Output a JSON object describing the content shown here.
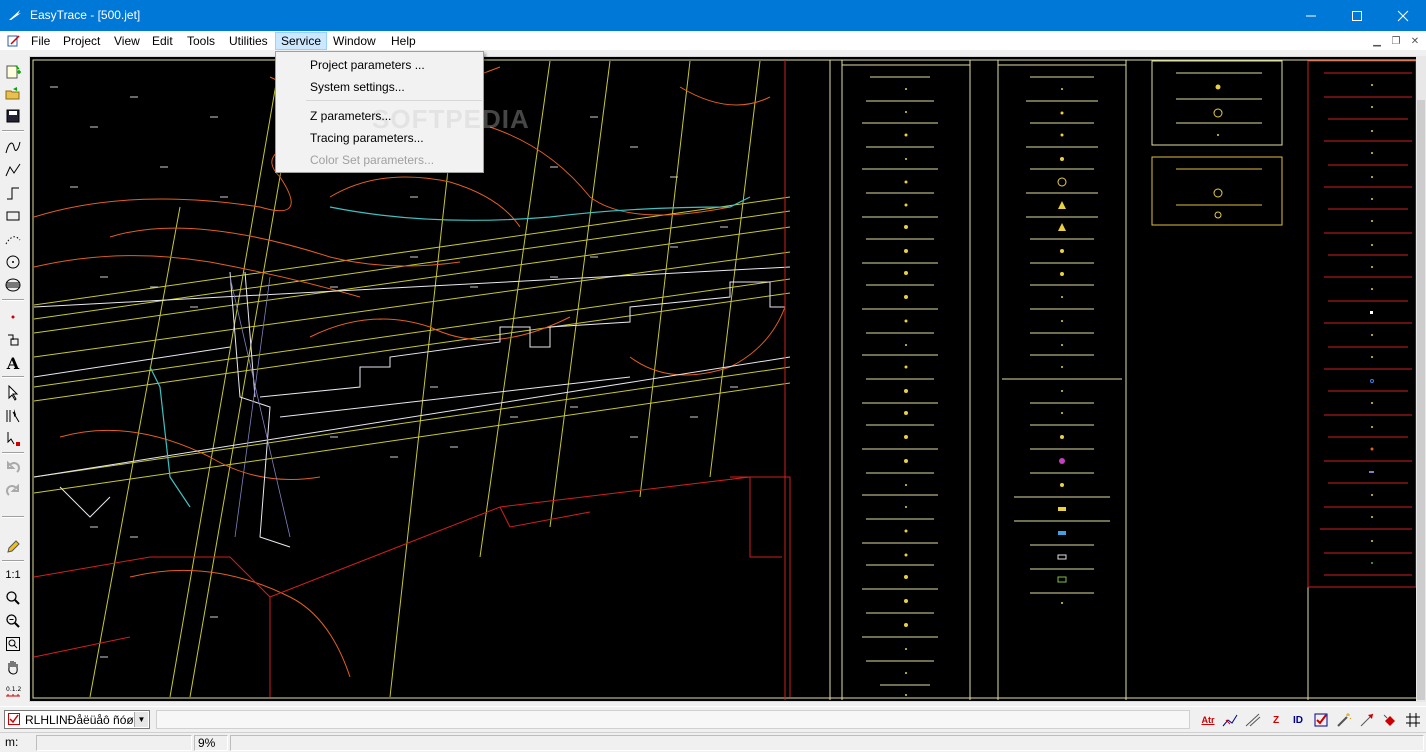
{
  "window": {
    "title": "EasyTrace - [500.jet]",
    "minimize_icon": "minimize-icon",
    "maximize_icon": "maximize-icon",
    "close_icon": "close-icon"
  },
  "menubar": {
    "items": [
      "File",
      "Project",
      "View",
      "Edit",
      "Tools",
      "Utilities",
      "Service",
      "Window",
      "Help"
    ],
    "active": "Service"
  },
  "service_menu": {
    "items": [
      {
        "label": "Project parameters ...",
        "enabled": true
      },
      {
        "label": "System settings...",
        "enabled": true
      },
      {
        "label": "Z parameters...",
        "enabled": true
      },
      {
        "label": "Tracing parameters...",
        "enabled": true
      },
      {
        "label": "Color Set parameters...",
        "enabled": false
      }
    ],
    "watermark": "SOFTPEDIA"
  },
  "left_toolbar": {
    "scale_label": "1:1",
    "tools": [
      "new-project-icon",
      "open-icon",
      "save-icon",
      "curve-icon",
      "polyline-icon",
      "orthogonal-line-icon",
      "rectangle-icon",
      "dotted-line-icon",
      "circle-icon",
      "hatch-icon",
      "point-icon",
      "symbol-icon",
      "text-tool-icon",
      "select-arrow-icon",
      "multi-select-icon",
      "node-select-icon",
      "undo-icon",
      "redo-icon",
      "pencil-icon",
      "zoom-in-icon",
      "zoom-out-icon",
      "zoom-extents-icon",
      "pan-hand-icon",
      "ruler-icon"
    ]
  },
  "bottom_toolbar": {
    "layer_value": "RLHLINÐåëüåô ñóøë",
    "tools": [
      "attributes-icon",
      "trace-icon",
      "line-snap-icon",
      "z-value-icon",
      "id-icon",
      "check-icon",
      "magic-wand-icon",
      "arrow-tool-icon",
      "fill-icon",
      "grid-icon"
    ],
    "tool_labels": {
      "attributes": "Atr",
      "z": "Z",
      "id": "ID"
    }
  },
  "status": {
    "m_label": "m:",
    "zoom": "9%"
  },
  "colors": {
    "titlebar": "#0078d7",
    "canvas": "#000000",
    "menu_highlight": "#cce8ff"
  }
}
